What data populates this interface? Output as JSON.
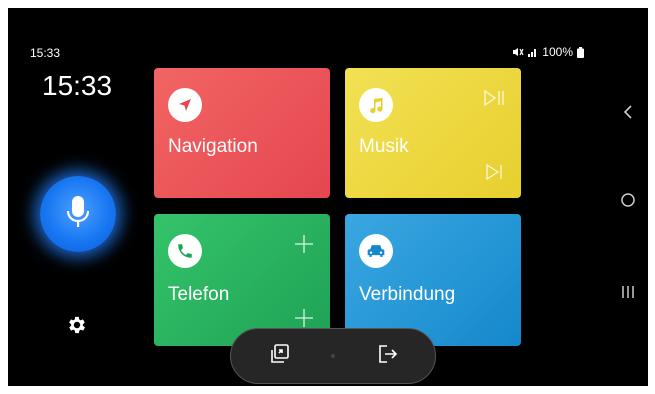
{
  "status_bar": {
    "time": "15:33",
    "battery": "100%"
  },
  "rail": {
    "clock": "15:33"
  },
  "tiles": [
    {
      "label": "Navigation",
      "icon": "navigation-arrow-icon"
    },
    {
      "label": "Musik",
      "icon": "music-note-icon"
    },
    {
      "label": "Telefon",
      "icon": "phone-icon"
    },
    {
      "label": "Verbindung",
      "icon": "car-icon"
    }
  ],
  "colors": {
    "navigation": "#e5464f",
    "music": "#e7cf2e",
    "phone": "#1ea255",
    "connection": "#1588cc",
    "mic": "#1877f2"
  }
}
